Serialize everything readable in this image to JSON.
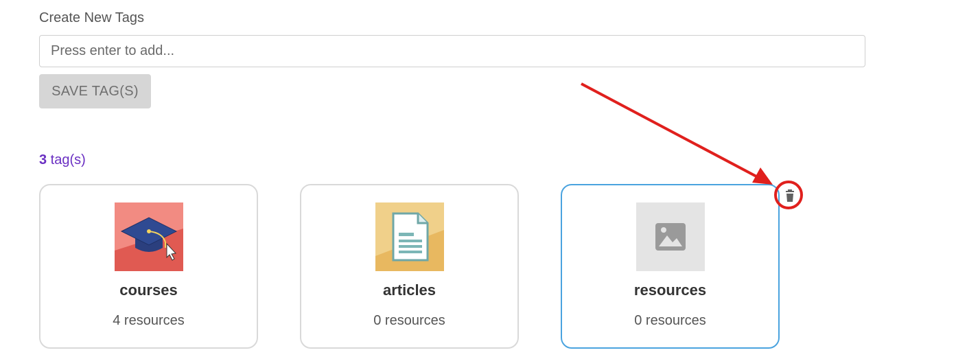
{
  "create_section": {
    "label": "Create New Tags",
    "input_placeholder": "Press enter to add...",
    "input_value": "",
    "save_button_label": "SAVE TAG(S)"
  },
  "tags_summary": {
    "count": "3",
    "suffix": " tag(s)"
  },
  "tags": [
    {
      "name": "courses",
      "count_label": "4 resources",
      "icon": "graduation-cap-icon",
      "thumb_color": "#f28b82"
    },
    {
      "name": "articles",
      "count_label": "0 resources",
      "icon": "document-icon",
      "thumb_color": "#f0d08a"
    },
    {
      "name": "resources",
      "count_label": "0 resources",
      "icon": "image-placeholder-icon",
      "thumb_color": "#e4e4e4",
      "selected": true
    }
  ],
  "colors": {
    "accent_purple": "#6a2fc2",
    "selected_border": "#4aa3df",
    "annotation_red": "#e0201d"
  }
}
